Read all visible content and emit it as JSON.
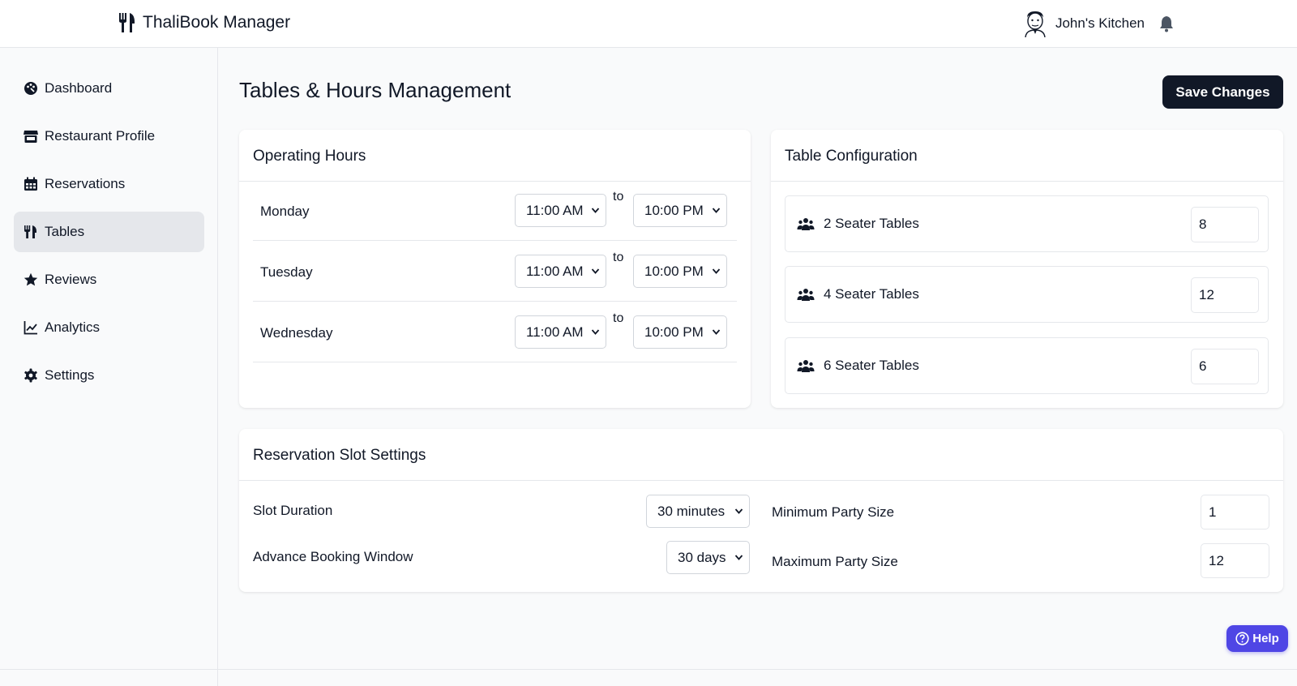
{
  "header": {
    "brand": "ThaliBook Manager",
    "brand_icon": "utensils-icon",
    "user_name": "John's Kitchen",
    "notification_icon": "bell-icon"
  },
  "sidebar": {
    "items": [
      {
        "label": "Dashboard",
        "icon": "palette-icon",
        "active": false
      },
      {
        "label": "Restaurant Profile",
        "icon": "store-icon",
        "active": false
      },
      {
        "label": "Reservations",
        "icon": "calendar-icon",
        "active": false
      },
      {
        "label": "Tables",
        "icon": "utensils-icon",
        "active": true
      },
      {
        "label": "Reviews",
        "icon": "star-icon",
        "active": false
      },
      {
        "label": "Analytics",
        "icon": "chart-line-icon",
        "active": false
      },
      {
        "label": "Settings",
        "icon": "gear-icon",
        "active": false
      }
    ]
  },
  "main": {
    "title": "Tables & Hours Management",
    "save_label": "Save Changes"
  },
  "operating_hours": {
    "title": "Operating Hours",
    "separator": "to",
    "days": [
      {
        "day": "Monday",
        "open": "11:00 AM",
        "close": "10:00 PM"
      },
      {
        "day": "Tuesday",
        "open": "11:00 AM",
        "close": "10:00 PM"
      },
      {
        "day": "Wednesday",
        "open": "11:00 AM",
        "close": "10:00 PM"
      }
    ]
  },
  "table_config": {
    "title": "Table Configuration",
    "tables": [
      {
        "label": "2 Seater Tables",
        "count": "8"
      },
      {
        "label": "4 Seater Tables",
        "count": "12"
      },
      {
        "label": "6 Seater Tables",
        "count": "6"
      }
    ]
  },
  "slot_settings": {
    "title": "Reservation Slot Settings",
    "slot_duration_label": "Slot Duration",
    "slot_duration_value": "30 minutes",
    "advance_window_label": "Advance Booking Window",
    "advance_window_value": "30 days",
    "min_party_label": "Minimum Party Size",
    "min_party_value": "1",
    "max_party_label": "Maximum Party Size",
    "max_party_value": "12"
  },
  "help": {
    "label": "Help"
  },
  "colors": {
    "primary_dark": "#111827",
    "help_accent": "#4f46e5",
    "active_nav": "#e5e7eb"
  }
}
